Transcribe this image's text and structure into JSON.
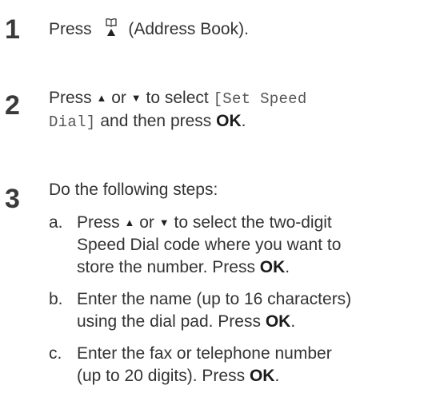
{
  "steps": [
    {
      "number": "1",
      "press": "Press",
      "address_icon": "address-book-icon",
      "after_icon": "(Address Book)."
    },
    {
      "number": "2",
      "press": "Press",
      "up_arrow": "▲",
      "or": "or",
      "down_arrow": "▼",
      "to_select": "to select",
      "menu_line1": "[Set Speed",
      "menu_line2": "Dial]",
      "and_then": "and then press",
      "ok": "OK",
      "period": "."
    },
    {
      "number": "3",
      "intro": "Do the following steps:",
      "substeps": [
        {
          "letter": "a.",
          "press": "Press",
          "up_arrow": "▲",
          "or": "or",
          "down_arrow": "▼",
          "line1_rest": "to select the two-digit",
          "line2": "Speed Dial code where you want to",
          "line3": "store the number. Press",
          "ok": "OK",
          "period": "."
        },
        {
          "letter": "b.",
          "line1": "Enter the name (up to 16 characters)",
          "line2": "using the dial pad. Press",
          "ok": "OK",
          "period": "."
        },
        {
          "letter": "c.",
          "line1": "Enter the fax or telephone number",
          "line2": "(up to 20 digits). Press",
          "ok": "OK",
          "period": "."
        }
      ]
    }
  ]
}
